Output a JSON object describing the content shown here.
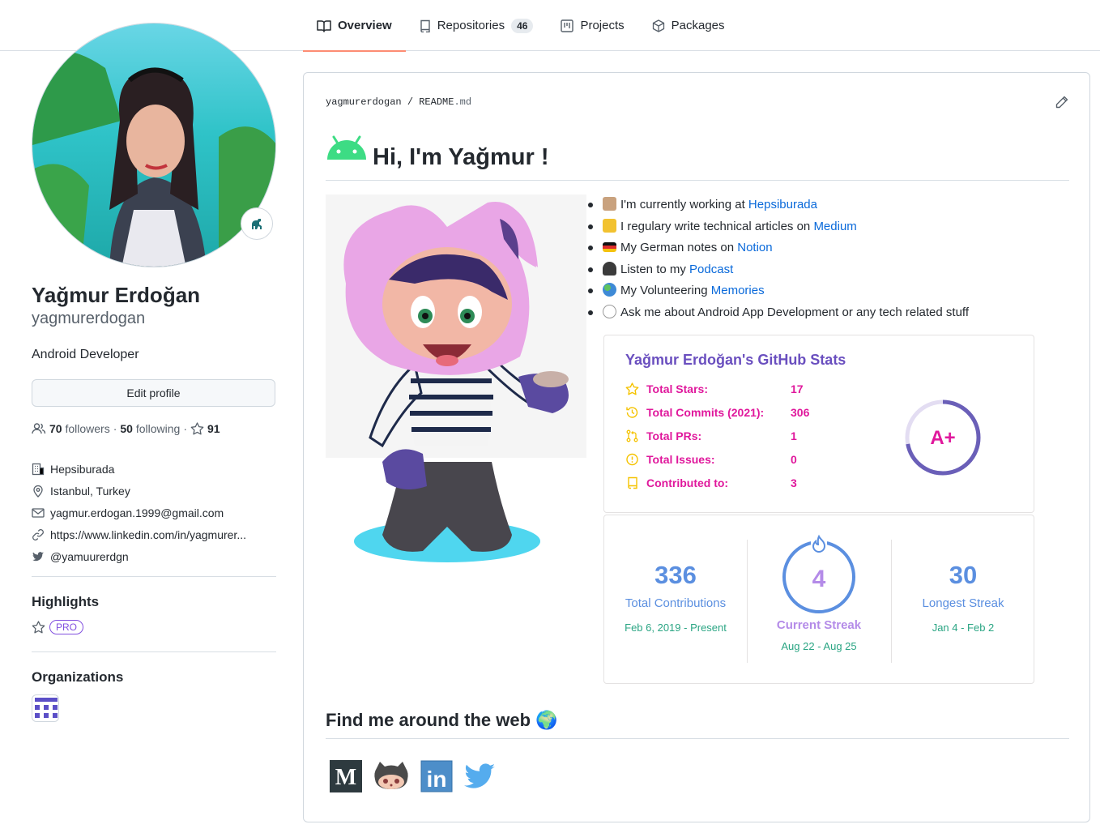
{
  "tabs": [
    {
      "label": "Overview",
      "icon": "book-icon",
      "active": true
    },
    {
      "label": "Repositories",
      "icon": "repo-icon",
      "count": "46"
    },
    {
      "label": "Projects",
      "icon": "project-icon"
    },
    {
      "label": "Packages",
      "icon": "package-icon"
    }
  ],
  "profile": {
    "full_name": "Yağmur Erdoğan",
    "login": "yagmurerdogan",
    "bio": "Android Developer",
    "edit_label": "Edit profile",
    "followers_count": "70",
    "followers_label": "followers",
    "following_count": "50",
    "following_label": "following",
    "stars_count": "91",
    "company": "Hepsiburada",
    "location": "Istanbul, Turkey",
    "email": "yagmur.erdogan.1999@gmail.com",
    "website": "https://www.linkedin.com/in/yagmurer...",
    "twitter": "@yamuurerdgn"
  },
  "highlights": {
    "title": "Highlights",
    "badge": "PRO"
  },
  "organizations": {
    "title": "Organizations"
  },
  "readme": {
    "owner": "yagmurerdogan",
    "sep": "/",
    "file": "README",
    "ext": ".md",
    "heading": "Hi, I'm Yağmur !",
    "bullets": [
      {
        "text": "I'm currently working at ",
        "link": "Hepsiburada",
        "emoji_color": "#c9a27e"
      },
      {
        "text": "I regulary write technical articles on ",
        "link": "Medium",
        "emoji_color": "#f2c230"
      },
      {
        "text": "My German notes on ",
        "link": "Notion",
        "emoji_color": "#dd2c2c"
      },
      {
        "text": "Listen to my ",
        "link": "Podcast",
        "emoji_color": "#3b3b3b"
      },
      {
        "text": "My Volunteering ",
        "link": "Memories",
        "emoji_color": "#3e8ad6"
      },
      {
        "text": "Ask me about Android App Development or any tech related stuff",
        "link": "",
        "emoji_color": "#c8c8c8"
      }
    ],
    "find_me": "Find me around the web 🌍"
  },
  "stats": {
    "title": "Yağmur Erdoğan's GitHub Stats",
    "rows": [
      {
        "label": "Total Stars:",
        "value": "17"
      },
      {
        "label": "Total Commits (2021):",
        "value": "306"
      },
      {
        "label": "Total PRs:",
        "value": "1"
      },
      {
        "label": "Total Issues:",
        "value": "0"
      },
      {
        "label": "Contributed to:",
        "value": "3"
      }
    ],
    "grade": "A+",
    "grade_progress": 0.72,
    "accent": "#e0189c",
    "icon_color": "#f5c300"
  },
  "streak": {
    "total": "336",
    "total_label": "Total Contributions",
    "total_range": "Feb 6, 2019 - Present",
    "current": "4",
    "current_label": "Current Streak",
    "current_range": "Aug 22 - Aug 25",
    "longest": "30",
    "longest_label": "Longest Streak",
    "longest_range": "Jan 4 - Feb 2"
  },
  "socials": [
    {
      "name": "medium-icon"
    },
    {
      "name": "github-icon"
    },
    {
      "name": "linkedin-icon"
    },
    {
      "name": "twitter-icon"
    }
  ]
}
